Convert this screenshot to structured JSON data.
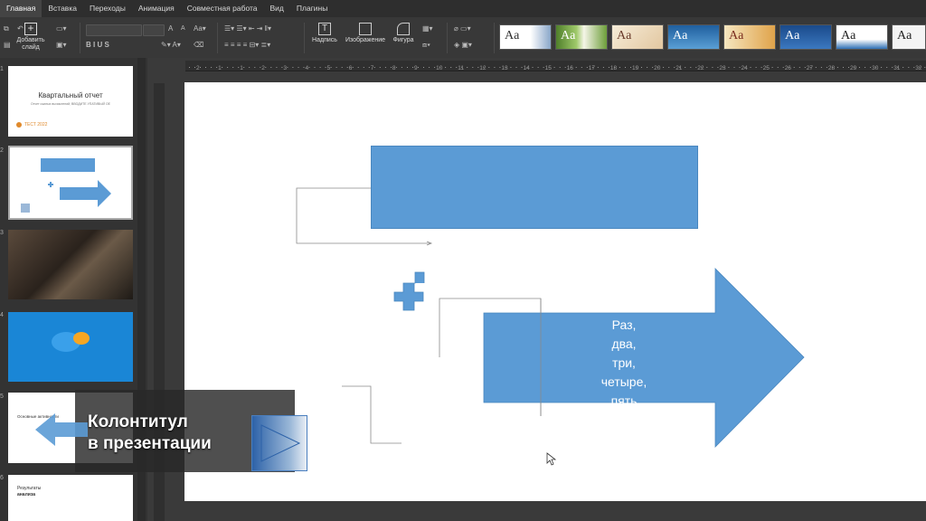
{
  "tabs": [
    "Главная",
    "Вставка",
    "Переходы",
    "Анимация",
    "Совместная работа",
    "Вид",
    "Плагины"
  ],
  "toolbar": {
    "add_slide_line1": "Добавить",
    "add_slide_line2": "слайд",
    "textbox_label": "Надпись",
    "image_label": "Изображение",
    "shape_label": "Фигура",
    "font_aa_large": "A",
    "font_aa_small": "A",
    "theme_aa": [
      "Aa",
      "Aa",
      "Aa",
      "Aa",
      "Aa",
      "Aa",
      "Aa",
      "Aa"
    ]
  },
  "ruler_numbers": [
    "2",
    "1",
    "1",
    "2",
    "3",
    "4",
    "5",
    "6",
    "7",
    "8",
    "9",
    "10",
    "11",
    "12",
    "13",
    "14",
    "15",
    "16",
    "17",
    "18",
    "19",
    "20",
    "21",
    "22",
    "23",
    "24",
    "25",
    "26",
    "27",
    "28",
    "29",
    "30",
    "31",
    "32",
    "33"
  ],
  "slides_panel": {
    "numbers": [
      "1",
      "2",
      "3",
      "4",
      "5",
      "6"
    ],
    "slide1_title": "Квартальный отчет",
    "slide1_sub": "Отчет сжатых вычислений, ВВОДИТЕ УПАТИВЫЙ ОЕ",
    "slide1_footer": "ТЕСТ 2022",
    "slide5_heading": "Основные активности",
    "slide6_title": "Результаты",
    "slide6_title2": "анализа"
  },
  "slide": {
    "arrow_text": [
      "Раз,",
      "два,",
      "три,",
      "четыре,",
      "пять"
    ]
  },
  "overlay": {
    "line1": "Колонтитул",
    "line2": "в презентации"
  },
  "colors": {
    "accent": "#5b9bd5",
    "app_bg": "#2b2b2b",
    "toolbar": "#383838"
  }
}
